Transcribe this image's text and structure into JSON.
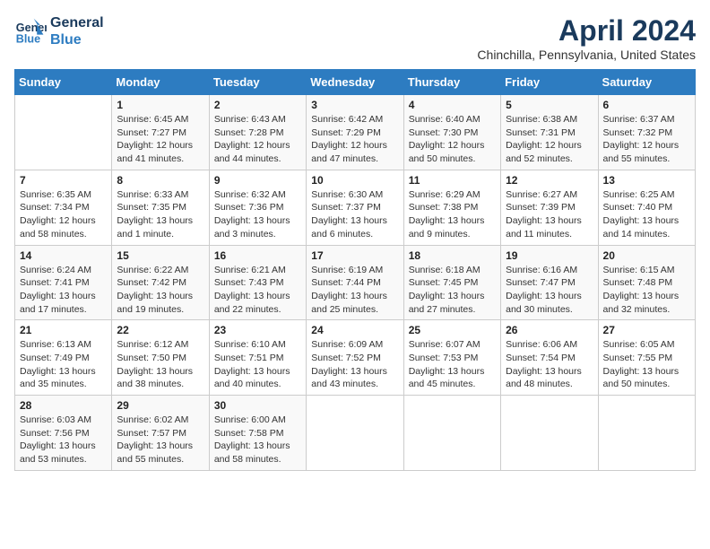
{
  "header": {
    "logo_line1": "General",
    "logo_line2": "Blue",
    "title": "April 2024",
    "subtitle": "Chinchilla, Pennsylvania, United States"
  },
  "weekdays": [
    "Sunday",
    "Monday",
    "Tuesday",
    "Wednesday",
    "Thursday",
    "Friday",
    "Saturday"
  ],
  "weeks": [
    [
      {
        "day": "",
        "sunrise": "",
        "sunset": "",
        "daylight": ""
      },
      {
        "day": "1",
        "sunrise": "Sunrise: 6:45 AM",
        "sunset": "Sunset: 7:27 PM",
        "daylight": "Daylight: 12 hours and 41 minutes."
      },
      {
        "day": "2",
        "sunrise": "Sunrise: 6:43 AM",
        "sunset": "Sunset: 7:28 PM",
        "daylight": "Daylight: 12 hours and 44 minutes."
      },
      {
        "day": "3",
        "sunrise": "Sunrise: 6:42 AM",
        "sunset": "Sunset: 7:29 PM",
        "daylight": "Daylight: 12 hours and 47 minutes."
      },
      {
        "day": "4",
        "sunrise": "Sunrise: 6:40 AM",
        "sunset": "Sunset: 7:30 PM",
        "daylight": "Daylight: 12 hours and 50 minutes."
      },
      {
        "day": "5",
        "sunrise": "Sunrise: 6:38 AM",
        "sunset": "Sunset: 7:31 PM",
        "daylight": "Daylight: 12 hours and 52 minutes."
      },
      {
        "day": "6",
        "sunrise": "Sunrise: 6:37 AM",
        "sunset": "Sunset: 7:32 PM",
        "daylight": "Daylight: 12 hours and 55 minutes."
      }
    ],
    [
      {
        "day": "7",
        "sunrise": "Sunrise: 6:35 AM",
        "sunset": "Sunset: 7:34 PM",
        "daylight": "Daylight: 12 hours and 58 minutes."
      },
      {
        "day": "8",
        "sunrise": "Sunrise: 6:33 AM",
        "sunset": "Sunset: 7:35 PM",
        "daylight": "Daylight: 13 hours and 1 minute."
      },
      {
        "day": "9",
        "sunrise": "Sunrise: 6:32 AM",
        "sunset": "Sunset: 7:36 PM",
        "daylight": "Daylight: 13 hours and 3 minutes."
      },
      {
        "day": "10",
        "sunrise": "Sunrise: 6:30 AM",
        "sunset": "Sunset: 7:37 PM",
        "daylight": "Daylight: 13 hours and 6 minutes."
      },
      {
        "day": "11",
        "sunrise": "Sunrise: 6:29 AM",
        "sunset": "Sunset: 7:38 PM",
        "daylight": "Daylight: 13 hours and 9 minutes."
      },
      {
        "day": "12",
        "sunrise": "Sunrise: 6:27 AM",
        "sunset": "Sunset: 7:39 PM",
        "daylight": "Daylight: 13 hours and 11 minutes."
      },
      {
        "day": "13",
        "sunrise": "Sunrise: 6:25 AM",
        "sunset": "Sunset: 7:40 PM",
        "daylight": "Daylight: 13 hours and 14 minutes."
      }
    ],
    [
      {
        "day": "14",
        "sunrise": "Sunrise: 6:24 AM",
        "sunset": "Sunset: 7:41 PM",
        "daylight": "Daylight: 13 hours and 17 minutes."
      },
      {
        "day": "15",
        "sunrise": "Sunrise: 6:22 AM",
        "sunset": "Sunset: 7:42 PM",
        "daylight": "Daylight: 13 hours and 19 minutes."
      },
      {
        "day": "16",
        "sunrise": "Sunrise: 6:21 AM",
        "sunset": "Sunset: 7:43 PM",
        "daylight": "Daylight: 13 hours and 22 minutes."
      },
      {
        "day": "17",
        "sunrise": "Sunrise: 6:19 AM",
        "sunset": "Sunset: 7:44 PM",
        "daylight": "Daylight: 13 hours and 25 minutes."
      },
      {
        "day": "18",
        "sunrise": "Sunrise: 6:18 AM",
        "sunset": "Sunset: 7:45 PM",
        "daylight": "Daylight: 13 hours and 27 minutes."
      },
      {
        "day": "19",
        "sunrise": "Sunrise: 6:16 AM",
        "sunset": "Sunset: 7:47 PM",
        "daylight": "Daylight: 13 hours and 30 minutes."
      },
      {
        "day": "20",
        "sunrise": "Sunrise: 6:15 AM",
        "sunset": "Sunset: 7:48 PM",
        "daylight": "Daylight: 13 hours and 32 minutes."
      }
    ],
    [
      {
        "day": "21",
        "sunrise": "Sunrise: 6:13 AM",
        "sunset": "Sunset: 7:49 PM",
        "daylight": "Daylight: 13 hours and 35 minutes."
      },
      {
        "day": "22",
        "sunrise": "Sunrise: 6:12 AM",
        "sunset": "Sunset: 7:50 PM",
        "daylight": "Daylight: 13 hours and 38 minutes."
      },
      {
        "day": "23",
        "sunrise": "Sunrise: 6:10 AM",
        "sunset": "Sunset: 7:51 PM",
        "daylight": "Daylight: 13 hours and 40 minutes."
      },
      {
        "day": "24",
        "sunrise": "Sunrise: 6:09 AM",
        "sunset": "Sunset: 7:52 PM",
        "daylight": "Daylight: 13 hours and 43 minutes."
      },
      {
        "day": "25",
        "sunrise": "Sunrise: 6:07 AM",
        "sunset": "Sunset: 7:53 PM",
        "daylight": "Daylight: 13 hours and 45 minutes."
      },
      {
        "day": "26",
        "sunrise": "Sunrise: 6:06 AM",
        "sunset": "Sunset: 7:54 PM",
        "daylight": "Daylight: 13 hours and 48 minutes."
      },
      {
        "day": "27",
        "sunrise": "Sunrise: 6:05 AM",
        "sunset": "Sunset: 7:55 PM",
        "daylight": "Daylight: 13 hours and 50 minutes."
      }
    ],
    [
      {
        "day": "28",
        "sunrise": "Sunrise: 6:03 AM",
        "sunset": "Sunset: 7:56 PM",
        "daylight": "Daylight: 13 hours and 53 minutes."
      },
      {
        "day": "29",
        "sunrise": "Sunrise: 6:02 AM",
        "sunset": "Sunset: 7:57 PM",
        "daylight": "Daylight: 13 hours and 55 minutes."
      },
      {
        "day": "30",
        "sunrise": "Sunrise: 6:00 AM",
        "sunset": "Sunset: 7:58 PM",
        "daylight": "Daylight: 13 hours and 58 minutes."
      },
      {
        "day": "",
        "sunrise": "",
        "sunset": "",
        "daylight": ""
      },
      {
        "day": "",
        "sunrise": "",
        "sunset": "",
        "daylight": ""
      },
      {
        "day": "",
        "sunrise": "",
        "sunset": "",
        "daylight": ""
      },
      {
        "day": "",
        "sunrise": "",
        "sunset": "",
        "daylight": ""
      }
    ]
  ]
}
